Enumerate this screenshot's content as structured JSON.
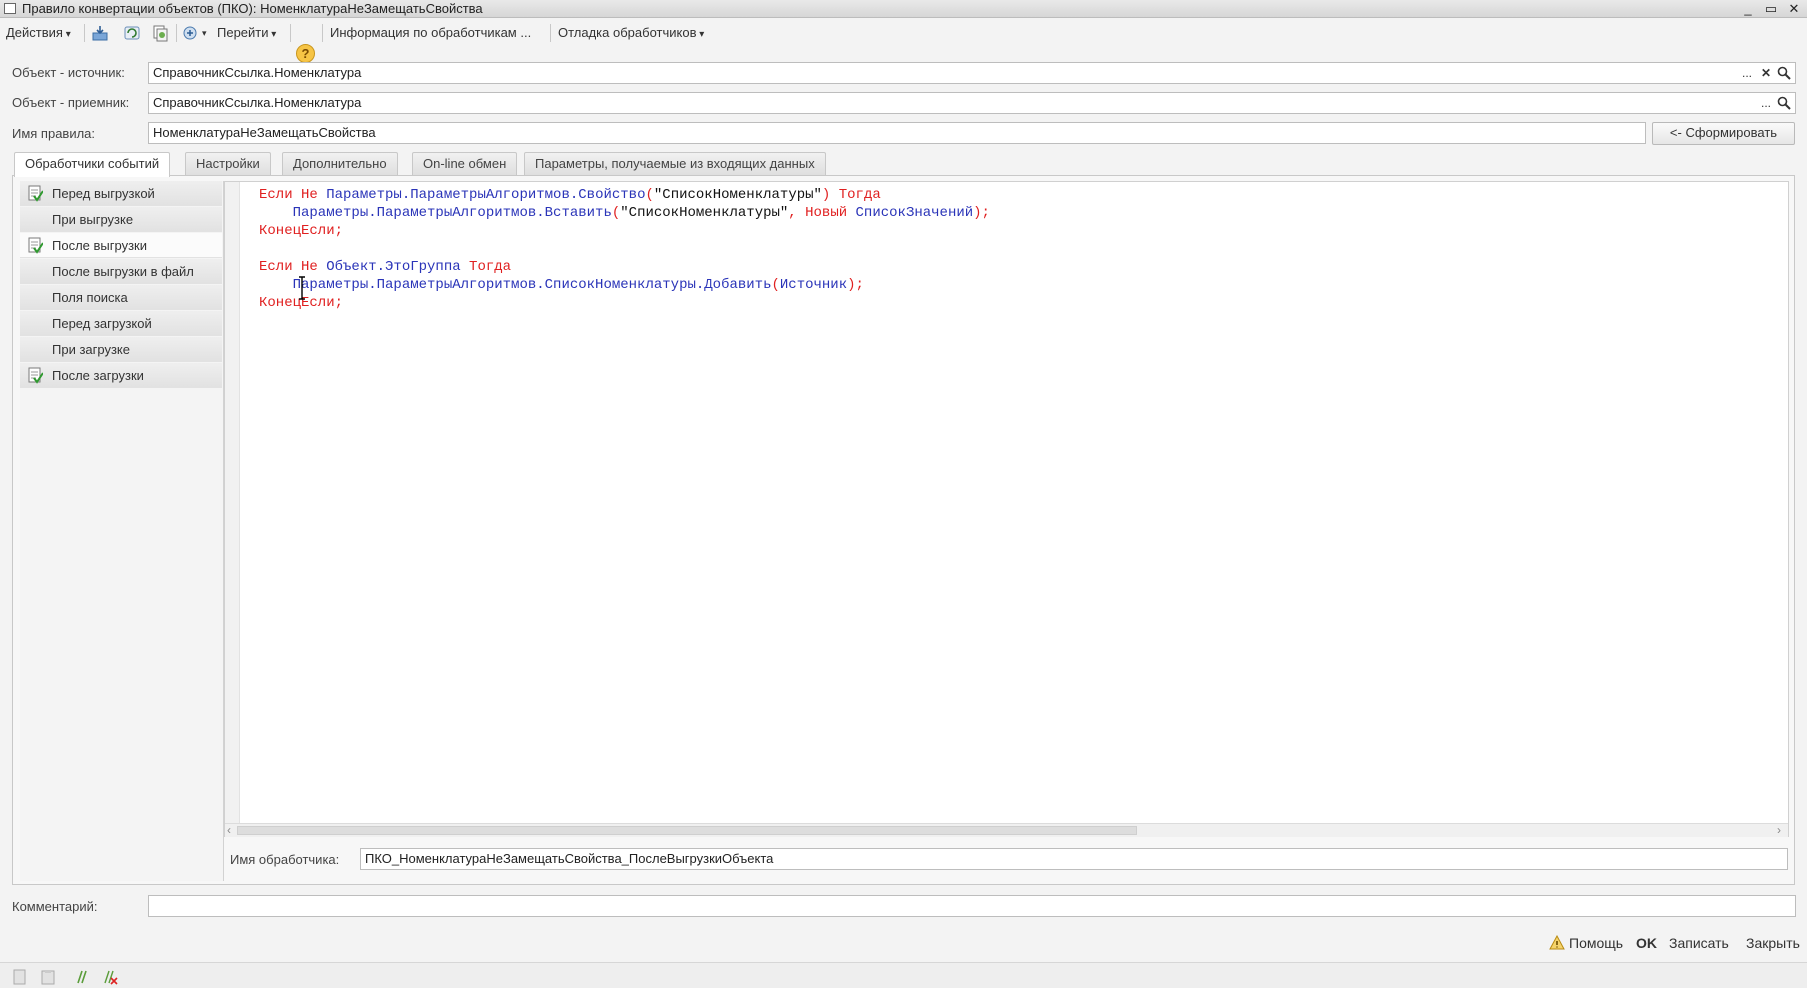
{
  "window": {
    "title": "Правило конвертации объектов (ПКО): НоменклатураНеЗамещатьСвойства",
    "controls": [
      "_",
      "▭",
      "✕"
    ]
  },
  "toolbar": {
    "actions_label": "Действия",
    "goto_label": "Перейти",
    "help_glyph": "?",
    "info_label": "Информация по обработчикам ...",
    "debug_label": "Отладка обработчиков",
    "icons": [
      "import-export-icon",
      "refresh-icon",
      "copy-icon",
      "wizard-icon",
      "help-icon"
    ]
  },
  "form": {
    "source_label": "Объект - источник:",
    "source_value": "СправочникСсылка.Номенклатура",
    "target_label": "Объект - приемник:",
    "target_value": "СправочникСсылка.Номенклатура",
    "rule_name_label": "Имя правила:",
    "rule_name_value": "НоменклатураНеЗамещатьСвойства",
    "generate_button": "<- Сформировать",
    "field_buttons": {
      "ellipsis": "...",
      "clear": "✕",
      "search": "🔍"
    }
  },
  "tabs": [
    {
      "label": "Обработчики событий",
      "active": true
    },
    {
      "label": "Настройки",
      "active": false
    },
    {
      "label": "Дополнительно",
      "active": false
    },
    {
      "label": "On-line обмен",
      "active": false
    },
    {
      "label": "Параметры, получаемые из входящих данных",
      "active": false
    }
  ],
  "events": [
    {
      "label": "Перед выгрузкой",
      "has_handler": true,
      "selected": false
    },
    {
      "label": "При выгрузке",
      "has_handler": false,
      "selected": false
    },
    {
      "label": "После выгрузки",
      "has_handler": true,
      "selected": true
    },
    {
      "label": "После выгрузки в файл",
      "has_handler": false,
      "selected": false
    },
    {
      "label": "Поля поиска",
      "has_handler": false,
      "selected": false
    },
    {
      "label": "Перед загрузкой",
      "has_handler": false,
      "selected": false
    },
    {
      "label": "При загрузке",
      "has_handler": false,
      "selected": false
    },
    {
      "label": "После загрузки",
      "has_handler": true,
      "selected": false
    }
  ],
  "code_lines": [
    [
      [
        "kw",
        "Если Не "
      ],
      [
        "id",
        "Параметры.ПараметрыАлгоритмов.Свойство"
      ],
      [
        "pu",
        "("
      ],
      [
        "str",
        "\"СписокНоменклатуры\""
      ],
      [
        "pu",
        ") "
      ],
      [
        "kw",
        "Тогда"
      ]
    ],
    [
      [
        "id",
        "    Параметры.ПараметрыАлгоритмов.Вставить"
      ],
      [
        "pu",
        "("
      ],
      [
        "str",
        "\"СписокНоменклатуры\""
      ],
      [
        "pu",
        ", "
      ],
      [
        "kw",
        "Новый "
      ],
      [
        "id",
        "СписокЗначений"
      ],
      [
        "pu",
        ");"
      ]
    ],
    [
      [
        "kw",
        "КонецЕсли"
      ],
      [
        "pu",
        ";"
      ]
    ],
    [
      [
        "str",
        ""
      ]
    ],
    [
      [
        "kw",
        "Если Не "
      ],
      [
        "id",
        "Объект.ЭтоГруппа "
      ],
      [
        "kw",
        "Тогда"
      ]
    ],
    [
      [
        "id",
        "    Параметры.ПараметрыАлгоритмов.СписокНоменклатуры.Добавить"
      ],
      [
        "pu",
        "("
      ],
      [
        "id",
        "Источник"
      ],
      [
        "pu",
        ");"
      ]
    ],
    [
      [
        "kw",
        "КонецЕсли"
      ],
      [
        "pu",
        ";"
      ]
    ]
  ],
  "handler": {
    "label": "Имя обработчика:",
    "value": "ПКО_НоменклатураНеЗамещатьСвойства_ПослеВыгрузкиОбъекта"
  },
  "comment": {
    "label": "Комментарий:",
    "value": ""
  },
  "footer": {
    "help_label": "Помощь",
    "ok_label": "OK",
    "save_label": "Записать",
    "close_label": "Закрыть"
  }
}
